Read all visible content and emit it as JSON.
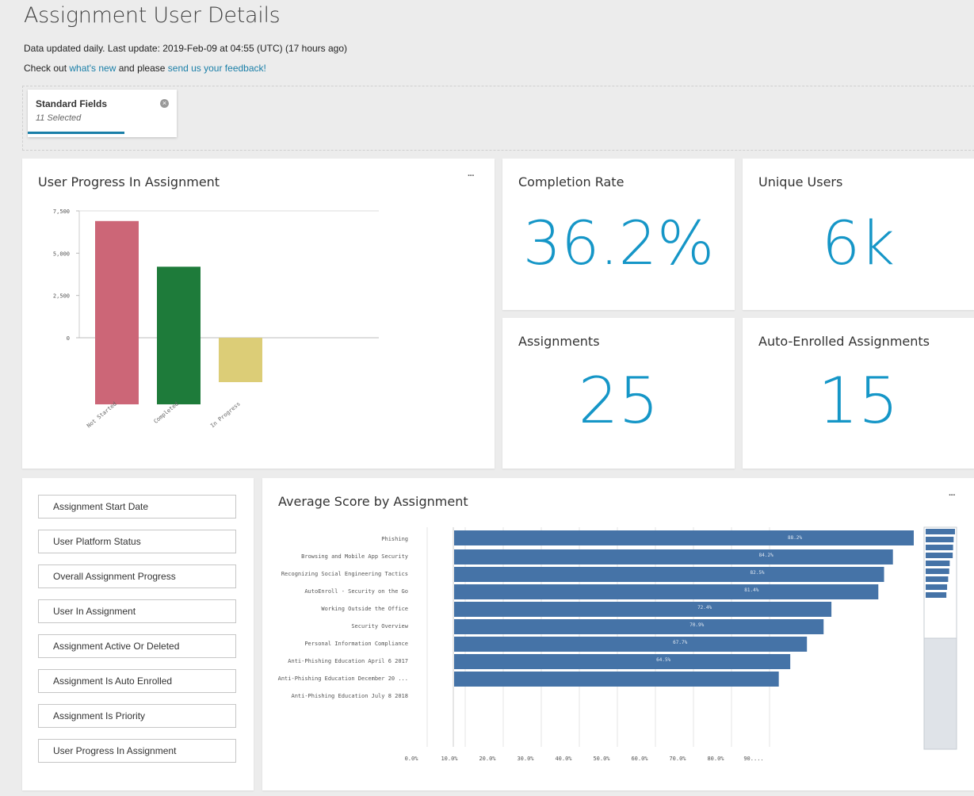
{
  "header": {
    "title": "Assignment User Details",
    "update_line": "Data updated daily. Last update: 2019-Feb-09 at 04:55 (UTC) (17 hours ago)",
    "check_prefix": "Check out ",
    "whats_new": "what's new",
    "check_middle": " and please ",
    "feedback": "send us your feedback!"
  },
  "filter": {
    "label": "Standard Fields",
    "sub": "11 Selected",
    "progress_fraction": 0.65
  },
  "progress_panel": {
    "title": "User Progress In Assignment",
    "more": "···"
  },
  "kpis": {
    "completion": {
      "label": "Completion Rate",
      "value": "36.2%"
    },
    "unique_users": {
      "label": "Unique Users",
      "value": "6k"
    },
    "assignments": {
      "label": "Assignments",
      "value": "25"
    },
    "auto_enrolled": {
      "label": "Auto-Enrolled Assignments",
      "value": "15"
    }
  },
  "fields": [
    "Assignment Start Date",
    "User Platform Status",
    "Overall Assignment Progress",
    "User In Assignment",
    "Assignment Active Or Deleted",
    "Assignment Is Auto Enrolled",
    "Assignment Is Priority",
    "User Progress In Assignment"
  ],
  "score_panel": {
    "title": "Average Score by Assignment",
    "more": "···"
  },
  "colors": {
    "accent": "#1596c7",
    "link": "#1a7fa8",
    "bar_blue": "#4573a7",
    "not_started": "#cc6677",
    "completed": "#1e7b3a",
    "in_progress": "#dccd77"
  },
  "chart_data": [
    {
      "type": "bar",
      "title": "User Progress In Assignment",
      "categories": [
        "Not Started",
        "Completed",
        "In Progress"
      ],
      "values": [
        6900,
        4200,
        0
      ],
      "colors": [
        "#cc6677",
        "#1e7b3a",
        "#dccd77"
      ],
      "y_ticks": [
        "7,500",
        "5,000",
        "2,500",
        "0"
      ],
      "ylim": [
        0,
        7500
      ],
      "grid": false
    },
    {
      "type": "bar",
      "orientation": "horizontal",
      "title": "Average Score by Assignment",
      "categories": [
        "Phishing",
        "Browsing and Mobile App Security",
        "Recognizing Social Engineering Tactics",
        "AutoEnroll - Security on the Go",
        "Working Outside the Office",
        "Security Overview",
        "Personal Information Compliance",
        "Anti-Phishing Education April 6 2017",
        "Anti-Phishing Education December 20 ...",
        "Anti-Phishing Education July 8 2018"
      ],
      "values": [
        88.2,
        84.2,
        82.5,
        81.4,
        72.4,
        70.9,
        67.7,
        64.5,
        62.3,
        58.8
      ],
      "data_labels": [
        "88.2%",
        "84.2%",
        "82.5%",
        "81.4%",
        "72.4%",
        "70.9%",
        "67.7%",
        "64.5%",
        "62.3%",
        "58.8%"
      ],
      "x_ticks": [
        "0.0%",
        "10.0%",
        "20.0%",
        "30.0%",
        "40.0%",
        "50.0%",
        "60.0%",
        "70.0%",
        "80.0%",
        "90...."
      ],
      "xlim": [
        0,
        95
      ],
      "grid": true
    }
  ]
}
